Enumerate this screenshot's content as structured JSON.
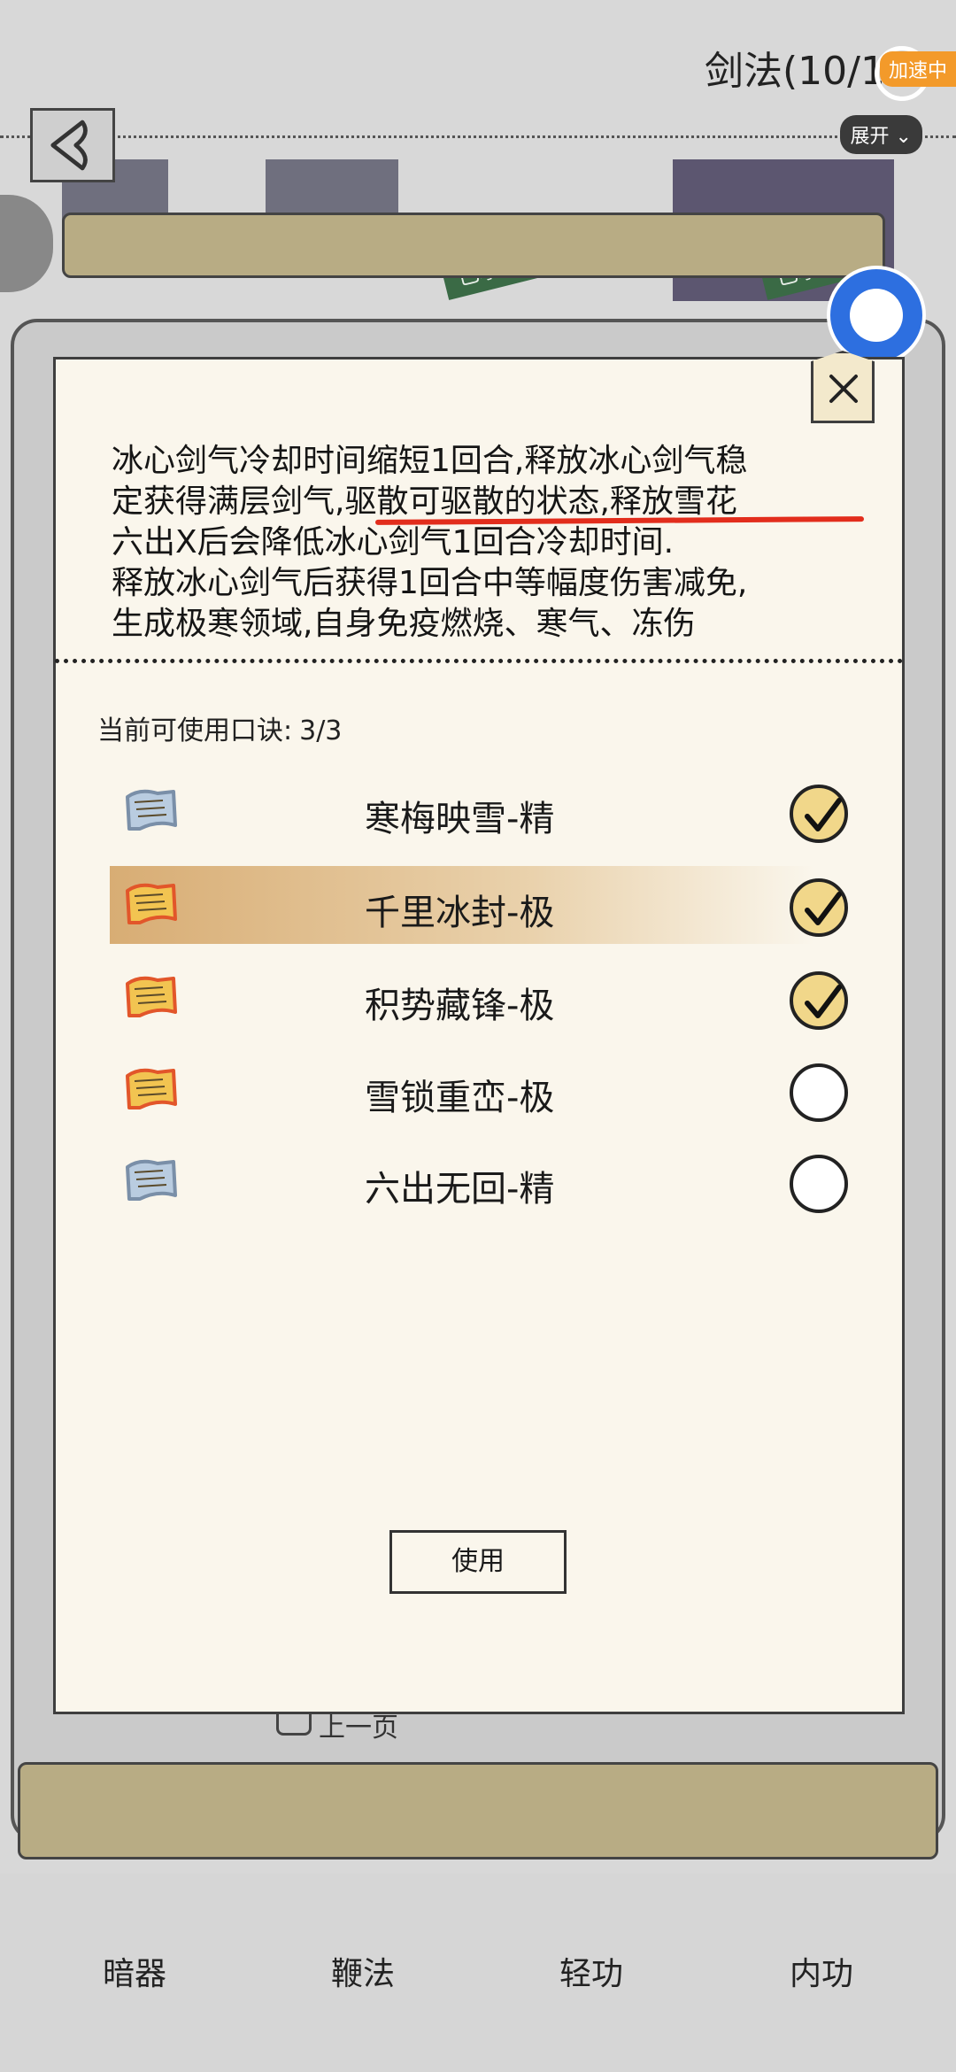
{
  "header": {
    "title": "剑法(10/1"
  },
  "overlay": {
    "accel_label": "加速中",
    "expand_label": "展开"
  },
  "scene": {
    "banner_left": "已孳会",
    "banner_right": "已孳会",
    "prev_page": "上一页"
  },
  "dialog": {
    "description_lines": [
      "冰心剑气冷却时间缩短1回合,释放冰心剑气稳",
      "定获得满层剑气,驱散可驱散的状态,释放雪花",
      "六出X后会降低冰心剑气1回合冷却时间.",
      "释放冰心剑气后获得1回合中等幅度伤害减免,",
      "生成极寒领域,自身免疫燃烧、寒气、冻伤"
    ],
    "available_label": "当前可使用口诀:",
    "available_count": "3/3",
    "skills": [
      {
        "name": "寒梅映雪-精",
        "scroll_color": "blue",
        "checked": true
      },
      {
        "name": "千里冰封-极",
        "scroll_color": "gold",
        "checked": true
      },
      {
        "name": "积势藏锋-极",
        "scroll_color": "gold",
        "checked": true
      },
      {
        "name": "雪锁重峦-极",
        "scroll_color": "gold",
        "checked": false
      },
      {
        "name": "六出无回-精",
        "scroll_color": "blue",
        "checked": false
      }
    ],
    "use_button": "使用"
  },
  "bottom_tabs": [
    "暗器",
    "鞭法",
    "轻功",
    "内功"
  ],
  "colors": {
    "underline": "#e22d1c",
    "highlight": "#d2a05f",
    "check_fill": "#f1d78a"
  }
}
